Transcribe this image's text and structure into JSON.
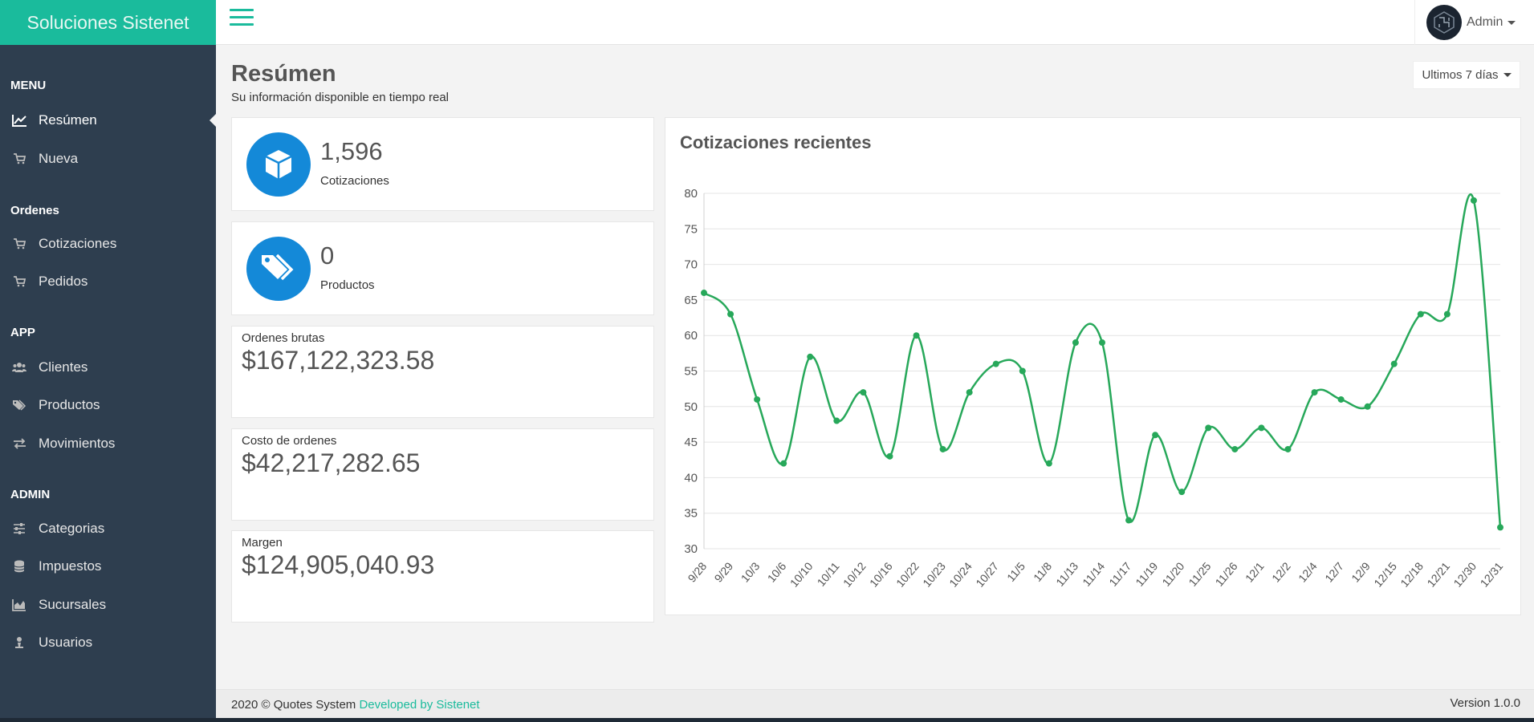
{
  "brand": "Soluciones Sistenet",
  "user": {
    "name": "Admin"
  },
  "sidebar": {
    "sections": [
      {
        "title": "MENU",
        "items": [
          {
            "label": "Resúmen",
            "icon": "chart-line-icon",
            "active": true
          },
          {
            "label": "Nueva",
            "icon": "cart-icon"
          }
        ]
      },
      {
        "title": "Ordenes",
        "items": [
          {
            "label": "Cotizaciones",
            "icon": "cart-icon"
          },
          {
            "label": "Pedidos",
            "icon": "cart-icon"
          }
        ]
      },
      {
        "title": "APP",
        "items": [
          {
            "label": "Clientes",
            "icon": "users-icon"
          },
          {
            "label": "Productos",
            "icon": "tags-icon"
          },
          {
            "label": "Movimientos",
            "icon": "exchange-icon"
          }
        ]
      },
      {
        "title": "ADMIN",
        "items": [
          {
            "label": "Categorias",
            "icon": "sliders-icon"
          },
          {
            "label": "Impuestos",
            "icon": "database-icon"
          },
          {
            "label": "Sucursales",
            "icon": "bar-chart-icon"
          },
          {
            "label": "Usuarios",
            "icon": "user-icon"
          }
        ]
      }
    ]
  },
  "header": {
    "title": "Resúmen",
    "subtitle": "Su información disponible en tiempo real",
    "range": "Ultimos 7 días"
  },
  "stats": [
    {
      "value": "1,596",
      "label": "Cotizaciones",
      "icon": "cube-icon"
    },
    {
      "value": "0",
      "label": "Productos",
      "icon": "tags-icon"
    }
  ],
  "money": [
    {
      "label": "Ordenes brutas",
      "value": "$167,122,323.58"
    },
    {
      "label": "Costo de ordenes",
      "value": "$42,217,282.65"
    },
    {
      "label": "Margen",
      "value": "$124,905,040.93"
    }
  ],
  "chart_data": {
    "type": "line",
    "title": "Cotizaciones recientes",
    "xlabel": "",
    "ylabel": "",
    "ylim": [
      30,
      80
    ],
    "yticks": [
      30,
      35,
      40,
      45,
      50,
      55,
      60,
      65,
      70,
      75,
      80
    ],
    "grid": true,
    "color": "#27a85a",
    "categories": [
      "9/28",
      "9/29",
      "10/3",
      "10/6",
      "10/10",
      "10/11",
      "10/12",
      "10/16",
      "10/22",
      "10/23",
      "10/24",
      "10/27",
      "11/5",
      "11/8",
      "11/13",
      "11/14",
      "11/17",
      "11/19",
      "11/20",
      "11/25",
      "11/26",
      "12/1",
      "12/2",
      "12/4",
      "12/7",
      "12/9",
      "12/15",
      "12/18",
      "12/21",
      "12/30",
      "12/31"
    ],
    "values": [
      66,
      63,
      51,
      42,
      57,
      48,
      52,
      43,
      60,
      44,
      52,
      56,
      55,
      42,
      59,
      59,
      34,
      46,
      38,
      47,
      44,
      47,
      44,
      52,
      51,
      50,
      56,
      63,
      63,
      79,
      33
    ]
  },
  "footer": {
    "copyright": "2020 © Quotes System",
    "link": "Developed by Sistenet",
    "version": "Version 1.0.0"
  }
}
